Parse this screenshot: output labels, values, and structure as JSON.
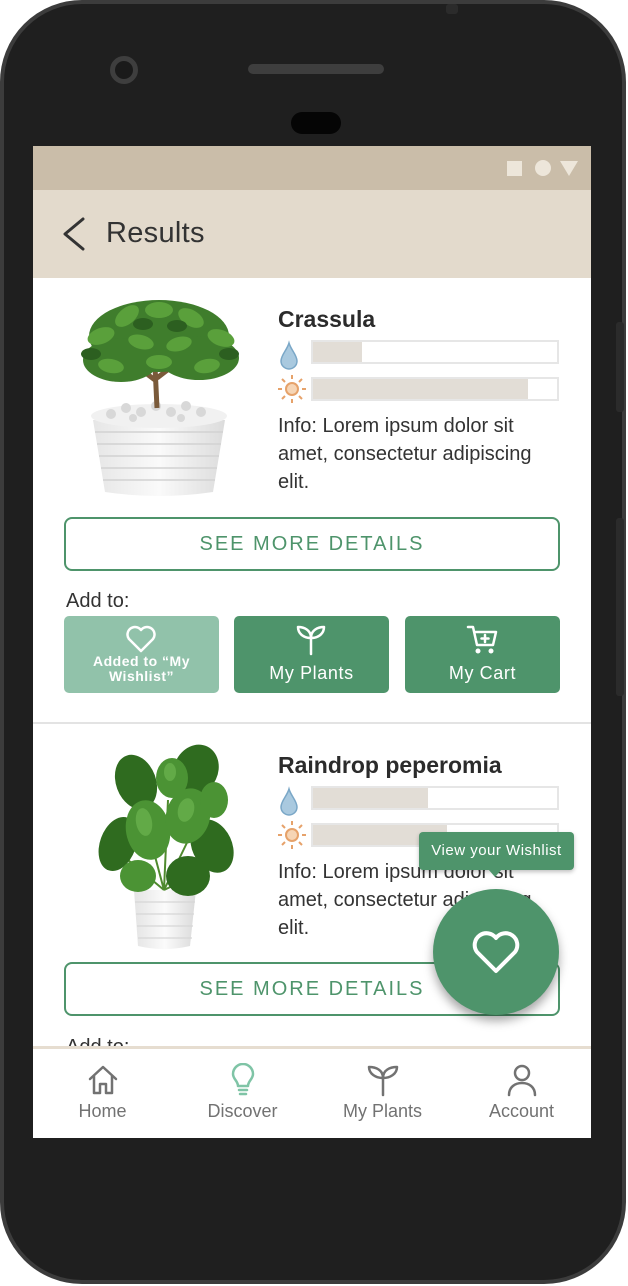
{
  "app_bar": {
    "title": "Results"
  },
  "plants": [
    {
      "name": "Crassula",
      "water_level": 0.2,
      "sun_level": 0.88,
      "info": "Info: Lorem ipsum dolor sit amet, consectetur adipiscing elit.",
      "details_label": "SEE MORE DETAILS",
      "add_to_label": "Add to:",
      "actions": {
        "wishlist": "Added to “My Wishlist”",
        "plants": "My Plants",
        "cart": "My Cart"
      }
    },
    {
      "name": "Raindrop peperomia",
      "water_level": 0.47,
      "sun_level": 0.55,
      "info": "Info: Lorem ipsum dolor sit amet, consectetur adipiscing elit.",
      "details_label": "SEE MORE DETAILS",
      "add_to_label": "Add to:"
    }
  ],
  "fab": {
    "tooltip": "View your Wishlist"
  },
  "bottom_nav": {
    "items": [
      {
        "label": "Home",
        "icon": "home-icon"
      },
      {
        "label": "Discover",
        "icon": "lightbulb-icon"
      },
      {
        "label": "My Plants",
        "icon": "sprout-icon"
      },
      {
        "label": "Account",
        "icon": "person-icon"
      }
    ]
  },
  "colors": {
    "primary": "#4e946b",
    "primary_faded": "#91c2aa",
    "status_bar": "#cabda9",
    "app_bar": "#e3dacc",
    "water_icon": "#7aa7c7",
    "sun_icon": "#e6a26a",
    "discover_icon": "#7fc4a6"
  }
}
